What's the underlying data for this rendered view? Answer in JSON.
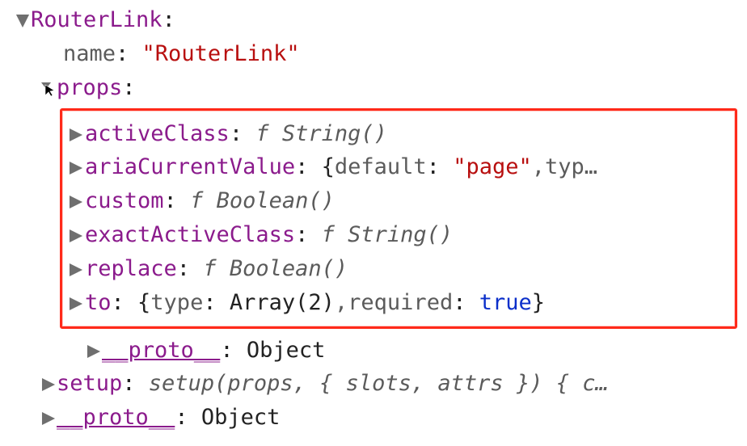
{
  "root": {
    "key": "RouterLink",
    "collapsed": false
  },
  "name_row": {
    "key": "name",
    "value": "\"RouterLink\""
  },
  "props_row": {
    "key": "props",
    "collapsed": false
  },
  "props": {
    "activeClass": {
      "key": "activeClass",
      "fn": "String()"
    },
    "ariaCurrentValue": {
      "key": "ariaCurrentValue",
      "brace_open": "{",
      "default_key": "default",
      "default_val": "\"page\"",
      "comma": ", ",
      "type_key": "typ",
      "ellipsis": "…"
    },
    "custom": {
      "key": "custom",
      "fn": "Boolean()"
    },
    "exactActiveClass": {
      "key": "exactActiveClass",
      "fn": "String()"
    },
    "replace": {
      "key": "replace",
      "fn": "Boolean()"
    },
    "to": {
      "key": "to",
      "brace_open": "{",
      "type_key": "type",
      "type_val": "Array(2)",
      "comma": ", ",
      "required_key": "required",
      "required_val": "true",
      "brace_close": "}"
    }
  },
  "props_proto": {
    "key": "__proto__",
    "value": "Object"
  },
  "setup_row": {
    "key": "setup",
    "sig": "setup(props, { slots, attrs }) { c",
    "ellipsis": "…"
  },
  "outer_proto": {
    "key": "__proto__",
    "value": "Object"
  },
  "glyphs": {
    "down": "▼",
    "right": "▶",
    "f": "f"
  }
}
